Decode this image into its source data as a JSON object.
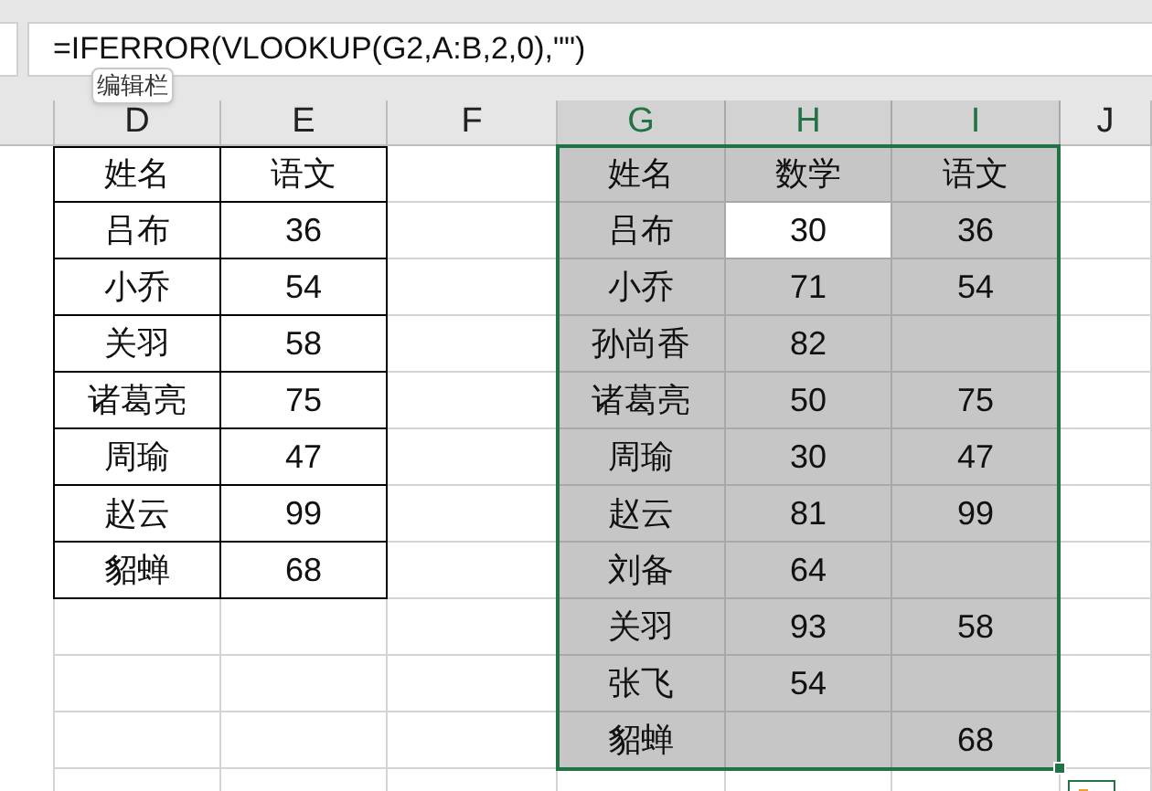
{
  "formula_bar": {
    "value": "=IFERROR(VLOOKUP(G2,A:B,2,0),\"\")"
  },
  "tooltip": {
    "text": "编辑栏"
  },
  "columns": [
    {
      "label": "D",
      "selected": false
    },
    {
      "label": "E",
      "selected": false
    },
    {
      "label": "F",
      "selected": false
    },
    {
      "label": "G",
      "selected": true
    },
    {
      "label": "H",
      "selected": true
    },
    {
      "label": "I",
      "selected": true
    },
    {
      "label": "J",
      "selected": false
    }
  ],
  "left_table": {
    "rows": [
      [
        "姓名",
        "语文"
      ],
      [
        "吕布",
        "36"
      ],
      [
        "小乔",
        "54"
      ],
      [
        "关羽",
        "58"
      ],
      [
        "诸葛亮",
        "75"
      ],
      [
        "周瑜",
        "47"
      ],
      [
        "赵云",
        "99"
      ],
      [
        "貂蝉",
        "68"
      ]
    ]
  },
  "right_table": {
    "rows": [
      [
        {
          "text": "姓名",
          "active": false
        },
        {
          "text": "数学",
          "active": false
        },
        {
          "text": "语文",
          "active": false
        }
      ],
      [
        {
          "text": "吕布",
          "active": false
        },
        {
          "text": "30",
          "active": true
        },
        {
          "text": "36",
          "active": false
        }
      ],
      [
        {
          "text": "小乔",
          "active": false
        },
        {
          "text": "71",
          "active": false
        },
        {
          "text": "54",
          "active": false
        }
      ],
      [
        {
          "text": "孙尚香",
          "active": false
        },
        {
          "text": "82",
          "active": false
        },
        {
          "active": false
        }
      ],
      [
        {
          "text": "诸葛亮",
          "active": false
        },
        {
          "text": "50",
          "active": false
        },
        {
          "text": "75",
          "active": false
        }
      ],
      [
        {
          "text": "周瑜",
          "active": false
        },
        {
          "text": "30",
          "active": false
        },
        {
          "text": "47",
          "active": false
        }
      ],
      [
        {
          "text": "赵云",
          "active": false
        },
        {
          "text": "81",
          "active": false
        },
        {
          "text": "99",
          "active": false
        }
      ],
      [
        {
          "text": "刘备",
          "active": false
        },
        {
          "text": "64",
          "active": false
        },
        {
          "active": false
        }
      ],
      [
        {
          "text": "关羽",
          "active": false
        },
        {
          "text": "93",
          "active": false
        },
        {
          "text": "58",
          "active": false
        }
      ],
      [
        {
          "text": "张飞",
          "active": false
        },
        {
          "text": "54",
          "active": false
        },
        {
          "active": false
        }
      ],
      [
        {
          "text": "貂蝉",
          "active": false
        },
        {
          "active": false
        },
        {
          "text": "68",
          "active": false
        }
      ]
    ]
  }
}
